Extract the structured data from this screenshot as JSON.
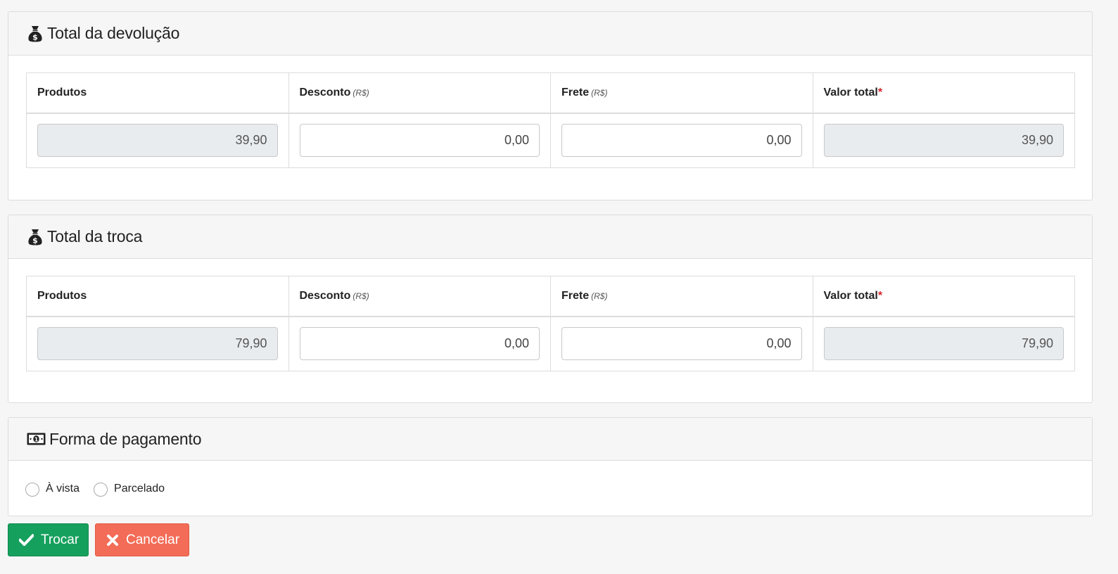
{
  "sections": [
    {
      "title": "Total da devolução",
      "icon": "money-bag-icon",
      "columns": [
        {
          "label": "Produtos",
          "unit": "",
          "required": ""
        },
        {
          "label": "Desconto",
          "unit": "(R$)",
          "required": ""
        },
        {
          "label": "Frete",
          "unit": "(R$)",
          "required": ""
        },
        {
          "label": "Valor total",
          "unit": "",
          "required": "*"
        }
      ],
      "values": {
        "produtos": "39,90",
        "desconto": "0,00",
        "frete": "0,00",
        "valor_total": "39,90"
      }
    },
    {
      "title": "Total da troca",
      "icon": "money-bag-icon",
      "columns": [
        {
          "label": "Produtos",
          "unit": "",
          "required": ""
        },
        {
          "label": "Desconto",
          "unit": "(R$)",
          "required": ""
        },
        {
          "label": "Frete",
          "unit": "(R$)",
          "required": ""
        },
        {
          "label": "Valor total",
          "unit": "",
          "required": "*"
        }
      ],
      "values": {
        "produtos": "79,90",
        "desconto": "0,00",
        "frete": "0,00",
        "valor_total": "79,90"
      }
    }
  ],
  "payment": {
    "title": "Forma de pagamento",
    "icon": "banknote-icon",
    "options": [
      {
        "label": "À vista",
        "checked": false
      },
      {
        "label": "Parcelado",
        "checked": false
      }
    ]
  },
  "actions": {
    "submit_label": "Trocar",
    "submit_icon": "check-icon",
    "cancel_label": "Cancelar",
    "cancel_icon": "times-icon"
  },
  "colors": {
    "success": "#16a05d",
    "danger": "#f36c57",
    "required": "#d9232d"
  }
}
